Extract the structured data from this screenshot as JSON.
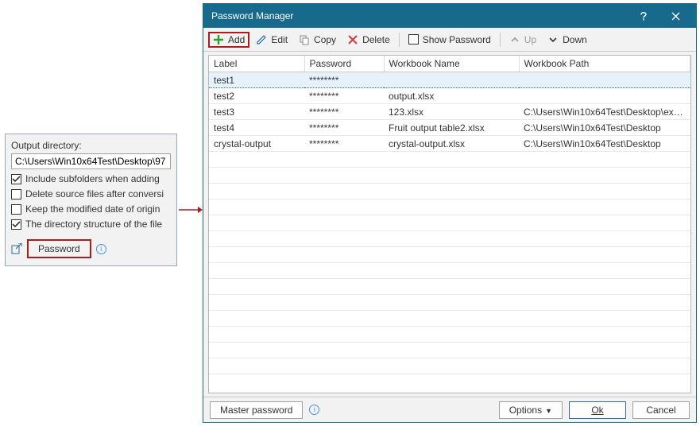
{
  "output": {
    "label": "Output directory:",
    "value": "C:\\Users\\Win10x64Test\\Desktop\\97",
    "checks": [
      {
        "checked": true,
        "label": "Include subfolders when adding"
      },
      {
        "checked": false,
        "label": "Delete source files after conversi"
      },
      {
        "checked": false,
        "label": "Keep the modified date of origin"
      },
      {
        "checked": true,
        "label": "The directory structure of the file"
      }
    ],
    "password_button": "Password"
  },
  "dialog": {
    "title": "Password Manager",
    "toolbar": {
      "add": "Add",
      "edit": "Edit",
      "copy": "Copy",
      "delete": "Delete",
      "show_password": "Show Password",
      "up": "Up",
      "down": "Down"
    },
    "columns": {
      "label": "Label",
      "password": "Password",
      "workbook_name": "Workbook Name",
      "workbook_path": "Workbook Path"
    },
    "rows": [
      {
        "label": "test1",
        "password": "********",
        "workbook_name": "",
        "workbook_path": ""
      },
      {
        "label": "test2",
        "password": "********",
        "workbook_name": "output.xlsx",
        "workbook_path": ""
      },
      {
        "label": "test3",
        "password": "********",
        "workbook_name": "123.xlsx",
        "workbook_path": "C:\\Users\\Win10x64Test\\Desktop\\export..."
      },
      {
        "label": "test4",
        "password": "********",
        "workbook_name": "Fruit output table2.xlsx",
        "workbook_path": "C:\\Users\\Win10x64Test\\Desktop"
      },
      {
        "label": "crystal-output",
        "password": "********",
        "workbook_name": "crystal-output.xlsx",
        "workbook_path": "C:\\Users\\Win10x64Test\\Desktop"
      }
    ],
    "empty_rows": 14,
    "master_password": "Master password",
    "options": "Options",
    "ok": "Ok",
    "cancel": "Cancel"
  }
}
